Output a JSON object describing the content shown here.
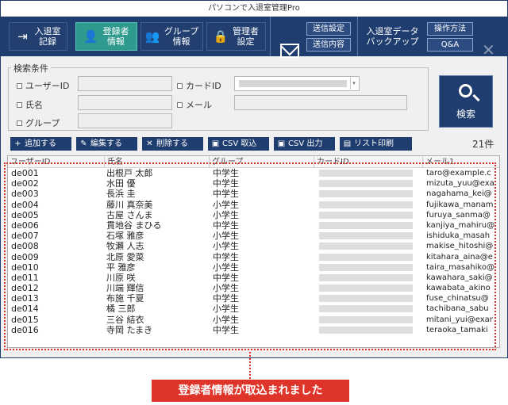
{
  "window": {
    "title": "パソコンで入退室管理Pro"
  },
  "nav": {
    "enter_exit": "入退室\n記録",
    "registrant": "登録者\n情報",
    "group": "グループ\n情報",
    "admin": "管理者\n設定",
    "send_settings": "送信設定",
    "send_content": "送信内容",
    "backup": "入退室データ\nバックアップ",
    "operation": "操作方法",
    "qa": "Q&A",
    "close": "✕"
  },
  "search": {
    "title": "検索条件",
    "user_id_label": "ユーザーID",
    "card_id_label": "カードID",
    "name_label": "氏名",
    "mail_label": "メール",
    "group_label": "グループ",
    "button_label": "検索"
  },
  "toolbar": {
    "add": "追加する",
    "edit": "編集する",
    "delete": "削除する",
    "csv_import": "CSV 取込",
    "csv_export": "CSV 出力",
    "print": "リスト印刷",
    "count": "21件"
  },
  "table": {
    "headers": [
      "ユーザーID",
      "氏名",
      "グループ",
      "カードID",
      "メール1"
    ],
    "rows": [
      [
        "de001",
        "出根戸 太郎",
        "中学生",
        "taro@example.c"
      ],
      [
        "de002",
        "水田 優",
        "中学生",
        "mizuta_yuu@exa"
      ],
      [
        "de003",
        "長浜 圭",
        "中学生",
        "nagahama_kei@"
      ],
      [
        "de004",
        "藤川 真奈美",
        "小学生",
        "fujikawa_manam"
      ],
      [
        "de005",
        "古屋 さんま",
        "小学生",
        "furuya_sanma@"
      ],
      [
        "de006",
        "貫地谷 まひる",
        "中学生",
        "kanjiya_mahiru@"
      ],
      [
        "de007",
        "石塚 雅彦",
        "小学生",
        "ishiduka_masah"
      ],
      [
        "de008",
        "牧瀬 人志",
        "小学生",
        "makise_hitoshi@"
      ],
      [
        "de009",
        "北原 愛菜",
        "中学生",
        "kitahara_aina@e"
      ],
      [
        "de010",
        "平 雅彦",
        "小学生",
        "taira_masahiko@"
      ],
      [
        "de011",
        "川原 咲",
        "中学生",
        "kawahara_saki@"
      ],
      [
        "de012",
        "川端 輝信",
        "小学生",
        "kawabata_akino"
      ],
      [
        "de013",
        "布施 千夏",
        "中学生",
        "fuse_chinatsu@"
      ],
      [
        "de014",
        "橘 三郎",
        "小学生",
        "tachibana_sabu"
      ],
      [
        "de015",
        "三谷 結衣",
        "小学生",
        "mitani_yui@exar"
      ],
      [
        "de016",
        "寺岡 たまき",
        "中学生",
        "teraoka_tamaki"
      ]
    ]
  },
  "caption": "登録者情報が取込まれました"
}
